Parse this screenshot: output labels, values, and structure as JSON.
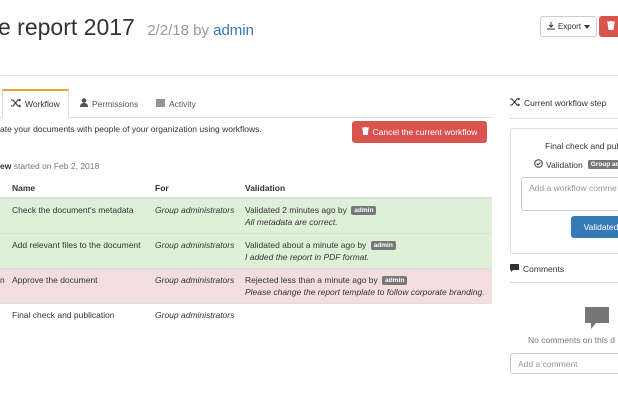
{
  "header": {
    "title": "e report 2017",
    "date": "2/2/18",
    "by_word": "by",
    "author": "admin",
    "export_label": "Export"
  },
  "tabs": [
    {
      "label": "Workflow",
      "icon": "shuffle-icon",
      "active": true
    },
    {
      "label": "Permissions",
      "icon": "user-icon",
      "active": false
    },
    {
      "label": "Activity",
      "icon": "list-icon",
      "active": false
    }
  ],
  "workflow": {
    "intro": "ate your documents with people of your organization using workflows.",
    "cancel_label": "Cancel the current workflow",
    "started_name": "ew",
    "started_text": " started on Feb 2, 2018",
    "columns": {
      "name": "Name",
      "for": "For",
      "validation": "Validation"
    },
    "rows": [
      {
        "prefix": "",
        "name": "Check the document's metadata",
        "for": "Group administrators",
        "status": "Validated 2 minutes ago by",
        "user": "admin",
        "note": "All metadata are correct."
      },
      {
        "prefix": "",
        "name": "Add relevant files to the document",
        "for": "Group administrators",
        "status": "Validated about a minute ago by",
        "user": "admin",
        "note": "I added the report in PDF format."
      },
      {
        "prefix": "n",
        "name": "Approve the document",
        "for": "Group administrators",
        "status": "Rejected less than a minute ago by",
        "user": "admin",
        "note": "Please change the report template to follow corporate branding."
      },
      {
        "prefix": "",
        "name": "Final check and publication",
        "for": "Group administrators",
        "status": "",
        "user": "",
        "note": ""
      }
    ]
  },
  "sidebar": {
    "current_step_title": "Current workflow step",
    "step_name": "Final check and pub",
    "validation_label": "Validation",
    "validation_badge": "Group ad",
    "comment_placeholder": "Add a workflow comme",
    "validated_label": "Validated",
    "comments_title": "Comments",
    "no_comments": "No comments on this d",
    "add_comment_placeholder": "Add a comment"
  },
  "colors": {
    "accent": "#e8a33c",
    "danger": "#d9534f",
    "primary": "#337ab7",
    "success_row": "#dff0d8",
    "danger_row": "#f2dede"
  }
}
